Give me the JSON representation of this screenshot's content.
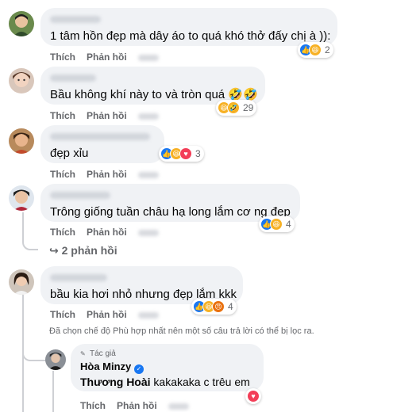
{
  "colors": {
    "like": "#1877f2",
    "haha": "#f7b125",
    "love": "#f33e58",
    "angry": "#e9710f",
    "bubble": "#f0f2f5",
    "meta": "#65676b"
  },
  "comments": [
    {
      "text": "1 tâm hồn đẹp mà dây áo to quá khó thở đấy chị à )):",
      "like": "Thích",
      "reply": "Phản hồi",
      "reactions": [
        "like",
        "haha"
      ],
      "count": "2"
    },
    {
      "text": "Bầu không khí này to và tròn quá 🤣🤣",
      "like": "Thích",
      "reply": "Phản hồi",
      "reactions": [
        "haha",
        "haha"
      ],
      "count": "29"
    },
    {
      "text": "đẹp xỉu",
      "like": "Thích",
      "reply": "Phản hồi",
      "reactions": [
        "like",
        "haha",
        "love"
      ],
      "count": "3"
    },
    {
      "text": "Trông giống tuần châu hạ long lắm cơ ng đẹp",
      "like": "Thích",
      "reply": "Phản hồi",
      "reactions": [
        "like",
        "haha"
      ],
      "count": "4"
    },
    {
      "text": "bầu kia hơi nhỏ nhưng đẹp lắm kkk",
      "like": "Thích",
      "reply": "Phản hồi",
      "reactions": [
        "like",
        "haha",
        "angry"
      ],
      "count": "4"
    }
  ],
  "more_replies": "2 phản hồi",
  "filter_note": "Đã chọn chế độ Phù hợp nhất nên một số câu trả lời có thể bị lọc ra.",
  "reply": {
    "author_badge": "Tác giả",
    "author": "Hòa Minzy",
    "mention": "Thương Hoài",
    "text": " kakakaka c trêu em",
    "like": "Thích",
    "reply": "Phản hồi"
  }
}
